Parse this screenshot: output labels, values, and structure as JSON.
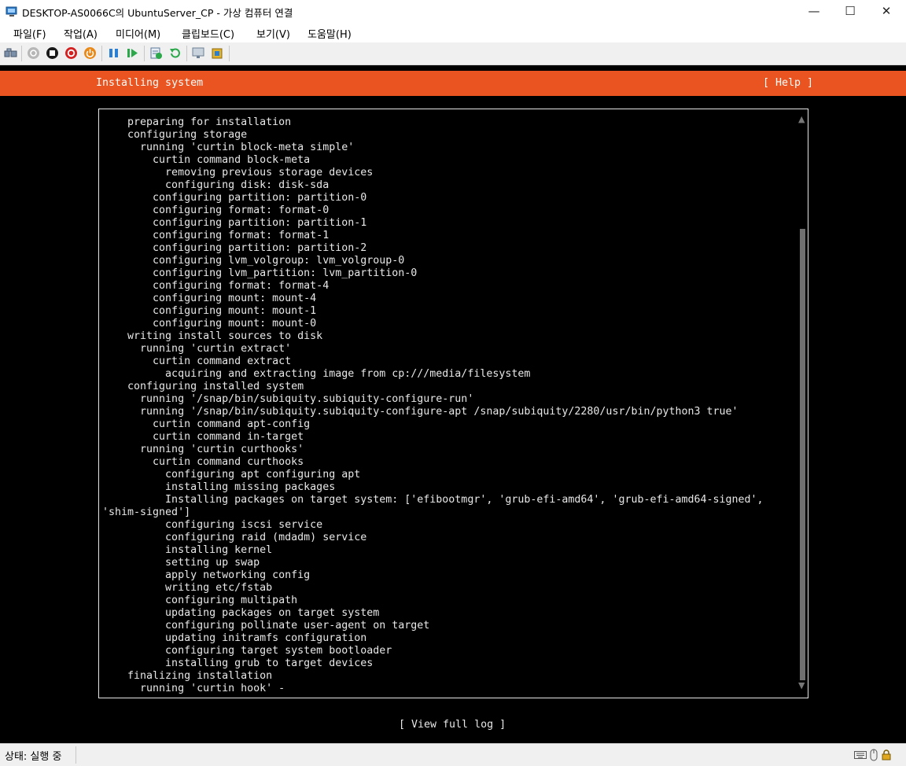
{
  "window": {
    "title": "DESKTOP-AS0066C의 UbuntuServer_CP - 가상 컴퓨터 연결",
    "controls": {
      "minimize": "—",
      "maximize": "☐",
      "close": "✕"
    }
  },
  "menu": [
    {
      "label": "파일(F)"
    },
    {
      "label": "작업(A)"
    },
    {
      "label": "미디어(M)"
    },
    {
      "label": "클립보드(C)"
    },
    {
      "label": "보기(V)"
    },
    {
      "label": "도움말(H)"
    }
  ],
  "toolbar": {
    "icons": [
      "ctrl-alt-del-icon",
      "start-icon",
      "turn-off-icon",
      "shut-down-icon",
      "power-icon",
      "pause-icon",
      "resume-icon",
      "checkpoint-icon",
      "revert-icon",
      "enhanced-session-icon",
      "share-icon"
    ]
  },
  "installer": {
    "header_title": "Installing system",
    "help_label": "[ Help ]",
    "view_log_label": "[ View full log ]",
    "log_lines": [
      "    preparing for installation",
      "    configuring storage",
      "      running 'curtin block-meta simple'",
      "        curtin command block-meta",
      "          removing previous storage devices",
      "          configuring disk: disk-sda",
      "        configuring partition: partition-0",
      "        configuring format: format-0",
      "        configuring partition: partition-1",
      "        configuring format: format-1",
      "        configuring partition: partition-2",
      "        configuring lvm_volgroup: lvm_volgroup-0",
      "        configuring lvm_partition: lvm_partition-0",
      "        configuring format: format-4",
      "        configuring mount: mount-4",
      "        configuring mount: mount-1",
      "        configuring mount: mount-0",
      "    writing install sources to disk",
      "      running 'curtin extract'",
      "        curtin command extract",
      "          acquiring and extracting image from cp:///media/filesystem",
      "    configuring installed system",
      "      running '/snap/bin/subiquity.subiquity-configure-run'",
      "      running '/snap/bin/subiquity.subiquity-configure-apt /snap/subiquity/2280/usr/bin/python3 true'",
      "        curtin command apt-config",
      "        curtin command in-target",
      "      running 'curtin curthooks'",
      "        curtin command curthooks",
      "          configuring apt configuring apt",
      "          installing missing packages",
      "          Installing packages on target system: ['efibootmgr', 'grub-efi-amd64', 'grub-efi-amd64-signed',",
      "'shim-signed']",
      "          configuring iscsi service",
      "          configuring raid (mdadm) service",
      "          installing kernel",
      "          setting up swap",
      "          apply networking config",
      "          writing etc/fstab",
      "          configuring multipath",
      "          updating packages on target system",
      "          configuring pollinate user-agent on target",
      "          updating initramfs configuration",
      "          configuring target system bootloader",
      "          installing grub to target devices",
      "    finalizing installation",
      "      running 'curtin hook' -"
    ],
    "scroll_up": "▲",
    "scroll_down": "▼"
  },
  "status": {
    "text": "상태: 실행 중"
  },
  "colors": {
    "ubuntu_orange": "#e95420",
    "terminal_bg": "#000000",
    "terminal_fg": "#e8e8e8"
  }
}
